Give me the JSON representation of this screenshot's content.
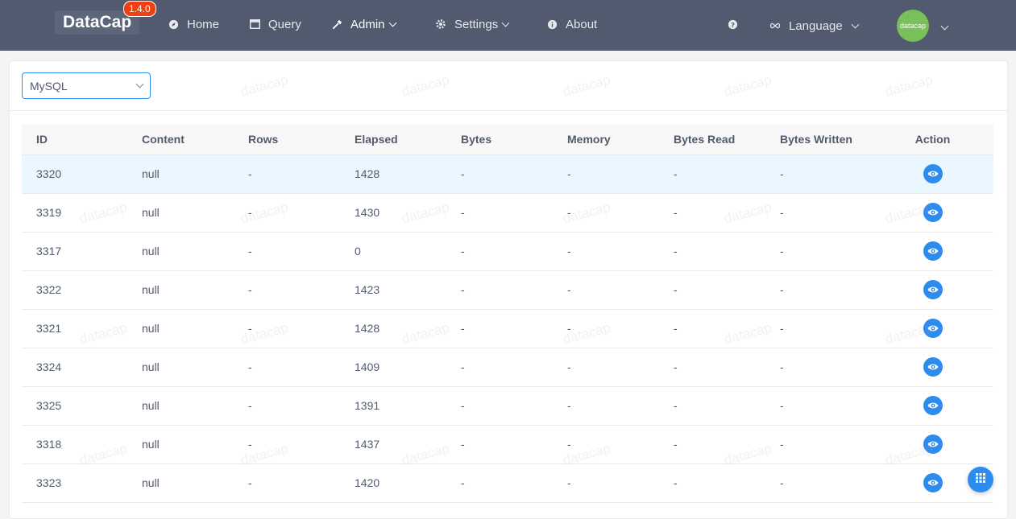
{
  "brand": {
    "name": "DataCap",
    "version": "1.4.0"
  },
  "nav": {
    "home": "Home",
    "query": "Query",
    "admin": "Admin",
    "settings": "Settings",
    "about": "About",
    "language": "Language"
  },
  "user": {
    "avatar_text": "datacap"
  },
  "source_select": {
    "value": "MySQL"
  },
  "watermark": "datacap",
  "table": {
    "headers": [
      "ID",
      "Content",
      "Rows",
      "Elapsed",
      "Bytes",
      "Memory",
      "Bytes Read",
      "Bytes Written",
      "Action"
    ],
    "rows": [
      [
        "3320",
        "null",
        "-",
        "1428",
        "-",
        "-",
        "-",
        "-"
      ],
      [
        "3319",
        "null",
        "-",
        "1430",
        "-",
        "-",
        "-",
        "-"
      ],
      [
        "3317",
        "null",
        "-",
        "0",
        "-",
        "-",
        "-",
        "-"
      ],
      [
        "3322",
        "null",
        "-",
        "1423",
        "-",
        "-",
        "-",
        "-"
      ],
      [
        "3321",
        "null",
        "-",
        "1428",
        "-",
        "-",
        "-",
        "-"
      ],
      [
        "3324",
        "null",
        "-",
        "1409",
        "-",
        "-",
        "-",
        "-"
      ],
      [
        "3325",
        "null",
        "-",
        "1391",
        "-",
        "-",
        "-",
        "-"
      ],
      [
        "3318",
        "null",
        "-",
        "1437",
        "-",
        "-",
        "-",
        "-"
      ],
      [
        "3323",
        "null",
        "-",
        "1420",
        "-",
        "-",
        "-",
        "-"
      ]
    ]
  },
  "colors": {
    "header_bg": "#515a6e",
    "primary": "#2d8cf0",
    "badge": "#ed4014",
    "avatar": "#7ac05a",
    "row_highlight": "#ebf7ff"
  }
}
